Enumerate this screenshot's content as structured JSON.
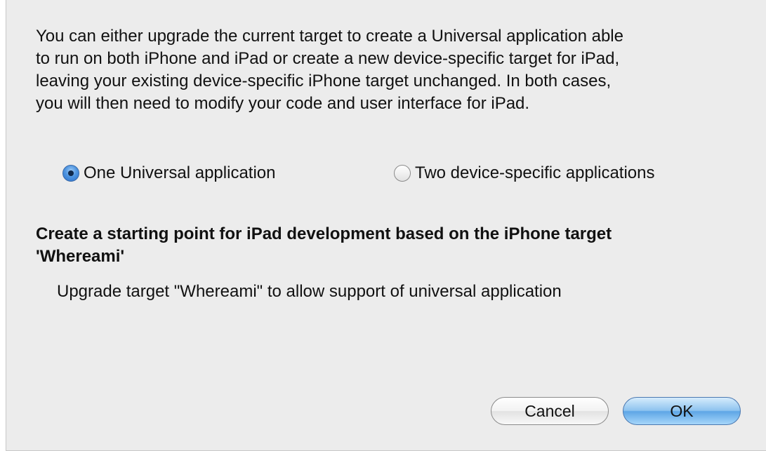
{
  "dialog": {
    "description": "You can either upgrade the current target to create a Universal application able\nto run on both iPhone and iPad or create a new device-specific target for iPad,\nleaving your existing device-specific iPhone target unchanged. In both cases,\nyou will then need to modify your code and user interface for iPad.",
    "options": [
      {
        "label": "One Universal application",
        "selected": true
      },
      {
        "label": "Two device-specific applications",
        "selected": false
      }
    ],
    "selected_heading": "Create a starting point for iPad development based on the iPhone target\n'Whereami'",
    "selected_detail": "Upgrade target \"Whereami\" to allow support of universal application",
    "buttons": {
      "cancel_label": "Cancel",
      "ok_label": "OK"
    }
  }
}
